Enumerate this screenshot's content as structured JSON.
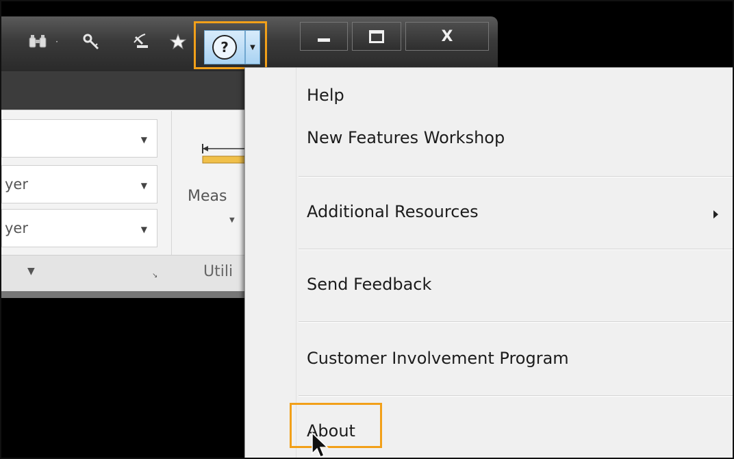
{
  "toolbar": {
    "icons": [
      "binoculars-icon",
      "key-icon",
      "satellite-icon",
      "favorites-star-icon",
      "help-icon"
    ],
    "help_symbol": "?",
    "window_buttons": {
      "minimize": "—",
      "maximize": "□",
      "close": "X"
    }
  },
  "ribbon": {
    "combos": [
      "",
      "yer",
      "yer"
    ],
    "measure_label": "Meas",
    "utilities_label": "Utili"
  },
  "menu": {
    "items": [
      {
        "label": "Help"
      },
      {
        "label": "New Features Workshop"
      },
      {
        "label": "Additional Resources",
        "submenu": true
      },
      {
        "label": "Send Feedback"
      },
      {
        "label": "Customer Involvement Program"
      },
      {
        "label": "About",
        "highlighted": true
      }
    ]
  },
  "colors": {
    "highlight": "#f2a019",
    "menu_bg": "#f0f0f0",
    "help_button": "#a9d2f2"
  }
}
